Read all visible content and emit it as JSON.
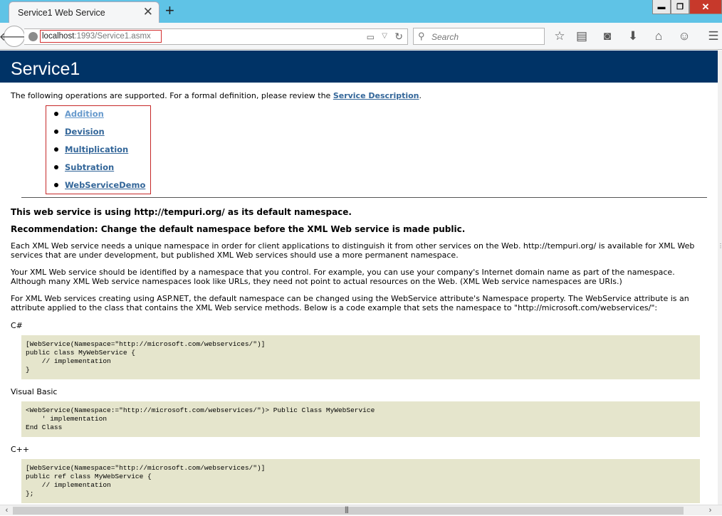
{
  "browser": {
    "tab_title": "Service1 Web Service",
    "tab_close": "✕",
    "new_tab": "+",
    "url_host": "localhost",
    "url_path": ":1993/Service1.asmx",
    "search_placeholder": "Search",
    "window_buttons": {
      "minimize": "▬",
      "restore": "❐",
      "close": "✕"
    }
  },
  "page": {
    "title": "Service1",
    "intro_text": "The following operations are supported. For a formal definition, please review the",
    "intro_link": "Service Description",
    "intro_end": ".",
    "operations": [
      "Addition",
      "Devision",
      "Multiplication",
      "Subtration",
      "WebServiceDemo"
    ],
    "namespace_notice": "This web service is using http://tempuri.org/ as its default namespace.",
    "recommendation": "Recommendation: Change the default namespace before the XML Web service is made public.",
    "paragraph1": "Each XML Web service needs a unique namespace in order for client applications to distinguish it from other services on the Web. http://tempuri.org/ is available for XML Web services that are under development, but published XML Web services should use a more permanent namespace.",
    "paragraph2": "Your XML Web service should be identified by a namespace that you control. For example, you can use your company's Internet domain name as part of the namespace. Although many XML Web service namespaces look like URLs, they need not point to actual resources on the Web. (XML Web service namespaces are URIs.)",
    "paragraph3": "For XML Web services creating using ASP.NET, the default namespace can be changed using the WebService attribute's Namespace property. The WebService attribute is an attribute applied to the class that contains the XML Web service methods. Below is a code example that sets the namespace to \"http://microsoft.com/webservices/\":",
    "csharp_label": "C#",
    "csharp_code": "[WebService(Namespace=\"http://microsoft.com/webservices/\")]\npublic class MyWebService {\n    // implementation\n}",
    "vb_label": "Visual Basic",
    "vb_code": "<WebService(Namespace:=\"http://microsoft.com/webservices/\")> Public Class MyWebService\n    ' implementation\nEnd Class",
    "cpp_label": "C++",
    "cpp_code": "[WebService(Namespace=\"http://microsoft.com/webservices/\")]\npublic ref class MyWebService {\n    // implementation\n};"
  },
  "colors": {
    "header_bg": "#003366",
    "link": "#336699",
    "code_bg": "#e5e5cc",
    "titlebar": "#5fc3e6",
    "highlight_box": "#c62828"
  }
}
